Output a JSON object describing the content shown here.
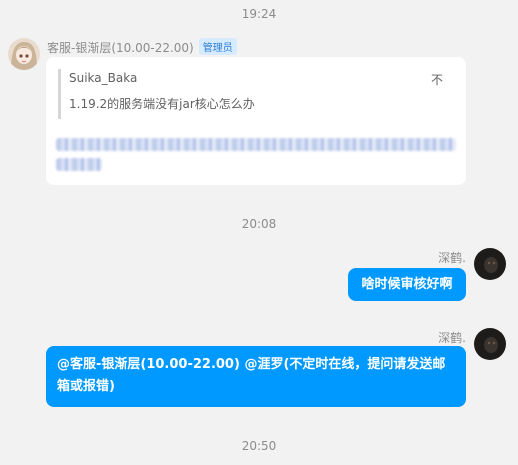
{
  "timestamps": [
    "19:24",
    "20:08",
    "20:50"
  ],
  "messages": [
    {
      "sender": "客服-银渐层(10.00-22.00)",
      "badge": "管理员",
      "quote": {
        "author": "Suika_Baka",
        "text": "1.19.2的服务端没有jar核心怎么办",
        "action": "不"
      },
      "body_blurred": true
    },
    {
      "sender": "深鹤.",
      "text": "啥时候审核好啊"
    },
    {
      "sender": "深鹤.",
      "text": "@客服-银渐层(10.00-22.00) @涯罗(不定时在线，提问请发送邮箱或报错)"
    }
  ],
  "colors": {
    "bubble_self": "#0099ff",
    "background": "#f2f2f2",
    "badge_text": "#2f7fd6",
    "badge_bg": "#d6ebff"
  }
}
